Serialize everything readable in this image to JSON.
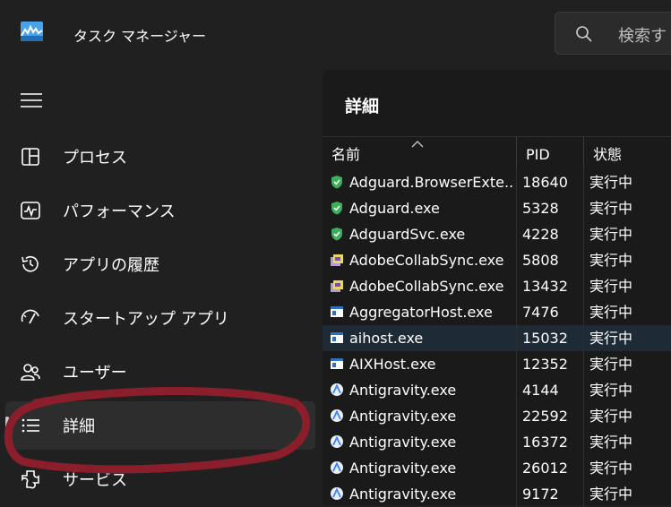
{
  "window": {
    "title": "タスク マネージャー"
  },
  "search": {
    "placeholder": "検索す"
  },
  "nav": {
    "items": [
      {
        "label": "プロセス",
        "icon": "processes-icon"
      },
      {
        "label": "パフォーマンス",
        "icon": "performance-icon"
      },
      {
        "label": "アプリの履歴",
        "icon": "history-icon"
      },
      {
        "label": "スタートアップ アプリ",
        "icon": "startup-icon"
      },
      {
        "label": "ユーザー",
        "icon": "users-icon"
      },
      {
        "label": "詳細",
        "icon": "details-icon",
        "active": true
      },
      {
        "label": "サービス",
        "icon": "services-icon"
      }
    ]
  },
  "main": {
    "title": "詳細",
    "columns": {
      "name": "名前",
      "pid": "PID",
      "status": "状態"
    },
    "rows": [
      {
        "name": "Adguard.BrowserExte...",
        "pid": "18640",
        "status": "実行中",
        "icon": "shield-icon"
      },
      {
        "name": "Adguard.exe",
        "pid": "5328",
        "status": "実行中",
        "icon": "shield-icon"
      },
      {
        "name": "AdguardSvc.exe",
        "pid": "4228",
        "status": "実行中",
        "icon": "shield-icon"
      },
      {
        "name": "AdobeCollabSync.exe",
        "pid": "5808",
        "status": "実行中",
        "icon": "adobe-icon"
      },
      {
        "name": "AdobeCollabSync.exe",
        "pid": "13432",
        "status": "実行中",
        "icon": "adobe-icon"
      },
      {
        "name": "AggregatorHost.exe",
        "pid": "7476",
        "status": "実行中",
        "icon": "window-app-icon"
      },
      {
        "name": "aihost.exe",
        "pid": "15032",
        "status": "実行中",
        "icon": "window-app-icon",
        "selected": true
      },
      {
        "name": "AIXHost.exe",
        "pid": "12352",
        "status": "実行中",
        "icon": "window-app-icon"
      },
      {
        "name": "Antigravity.exe",
        "pid": "4144",
        "status": "実行中",
        "icon": "antigravity-icon"
      },
      {
        "name": "Antigravity.exe",
        "pid": "22592",
        "status": "実行中",
        "icon": "antigravity-icon"
      },
      {
        "name": "Antigravity.exe",
        "pid": "16372",
        "status": "実行中",
        "icon": "antigravity-icon"
      },
      {
        "name": "Antigravity.exe",
        "pid": "26012",
        "status": "実行中",
        "icon": "antigravity-icon"
      },
      {
        "name": "Antigravity.exe",
        "pid": "9172",
        "status": "実行中",
        "icon": "antigravity-icon"
      }
    ]
  },
  "colors": {
    "accent_highlight": "#8b1e2b",
    "selected_row": "#1e2a36",
    "shield_green": "#3fae5a"
  }
}
